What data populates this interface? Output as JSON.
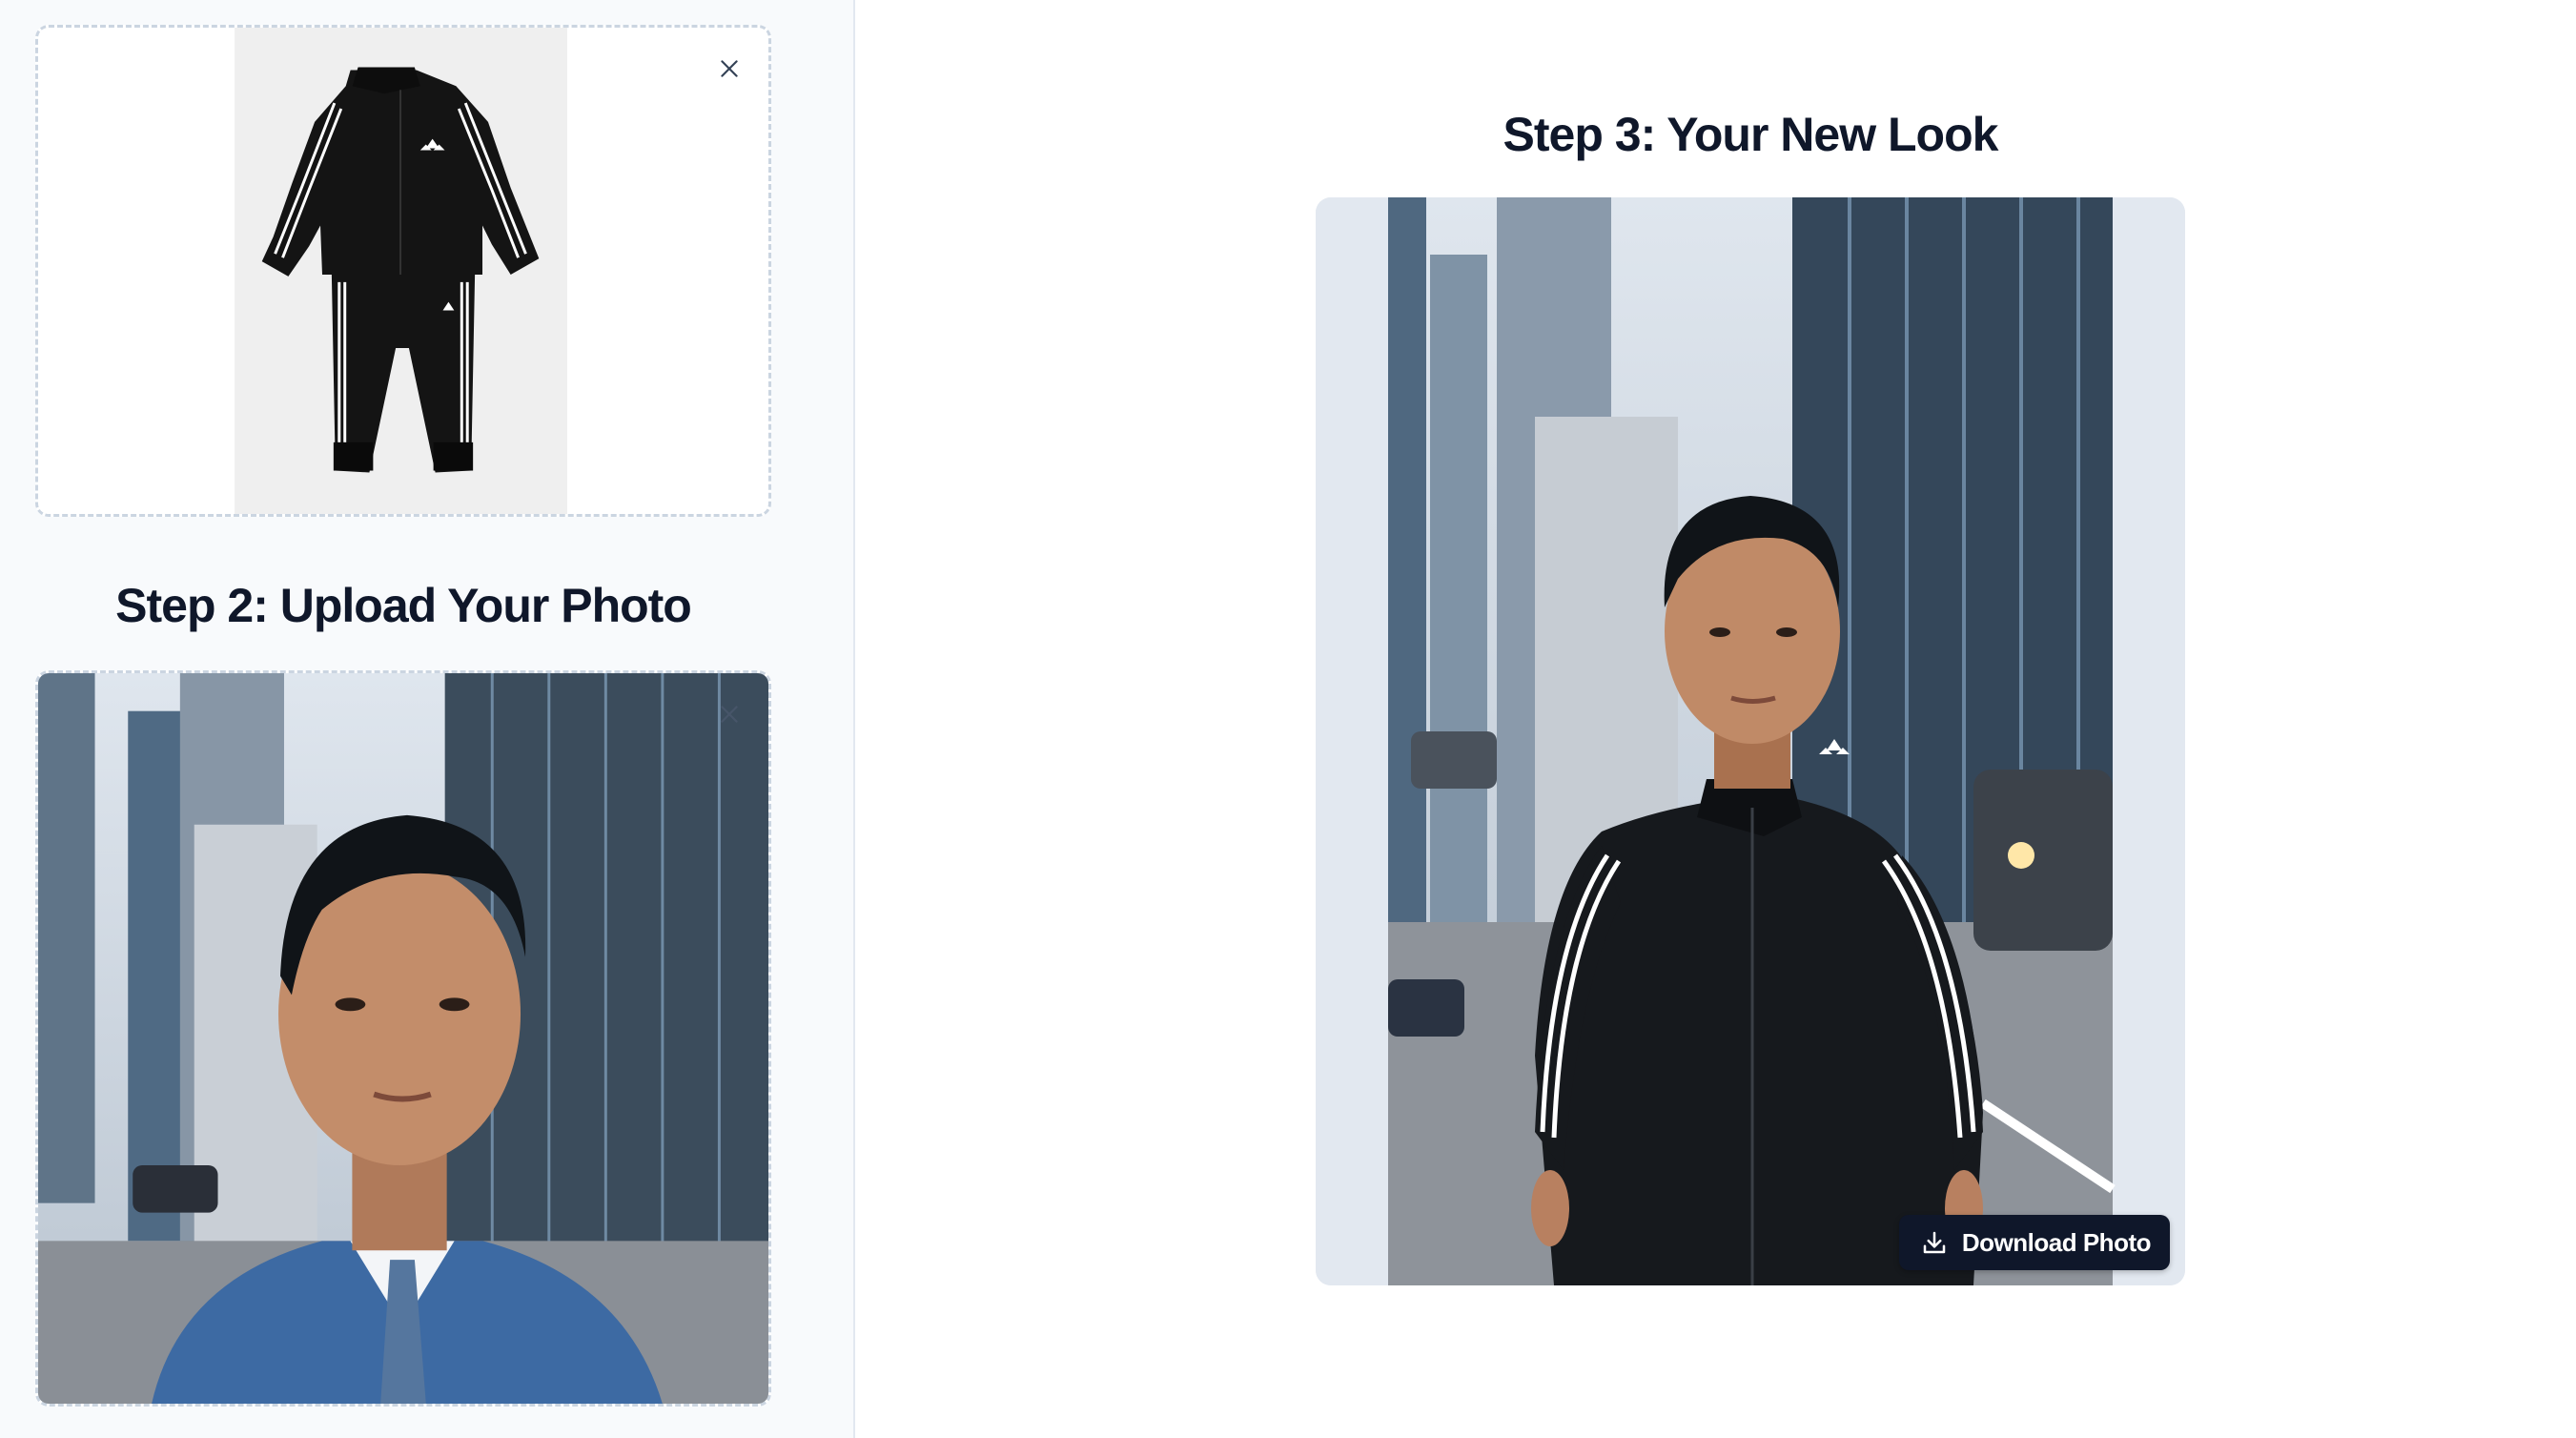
{
  "steps": {
    "step2_title": "Step 2: Upload Your Photo",
    "step3_title": "Step 3: Your New Look"
  },
  "garment": {
    "logo_text": "adidas",
    "remove_icon": "close-icon"
  },
  "photo": {
    "remove_icon": "close-icon"
  },
  "result": {
    "download_label": "Download Photo",
    "download_icon": "download-icon",
    "logo_text": "adidas"
  },
  "colors": {
    "accent": "#0f172a",
    "sidebar_bg": "#f8fafc",
    "dropzone_border": "#cbd5e1",
    "result_bg": "#e2e8f0"
  }
}
